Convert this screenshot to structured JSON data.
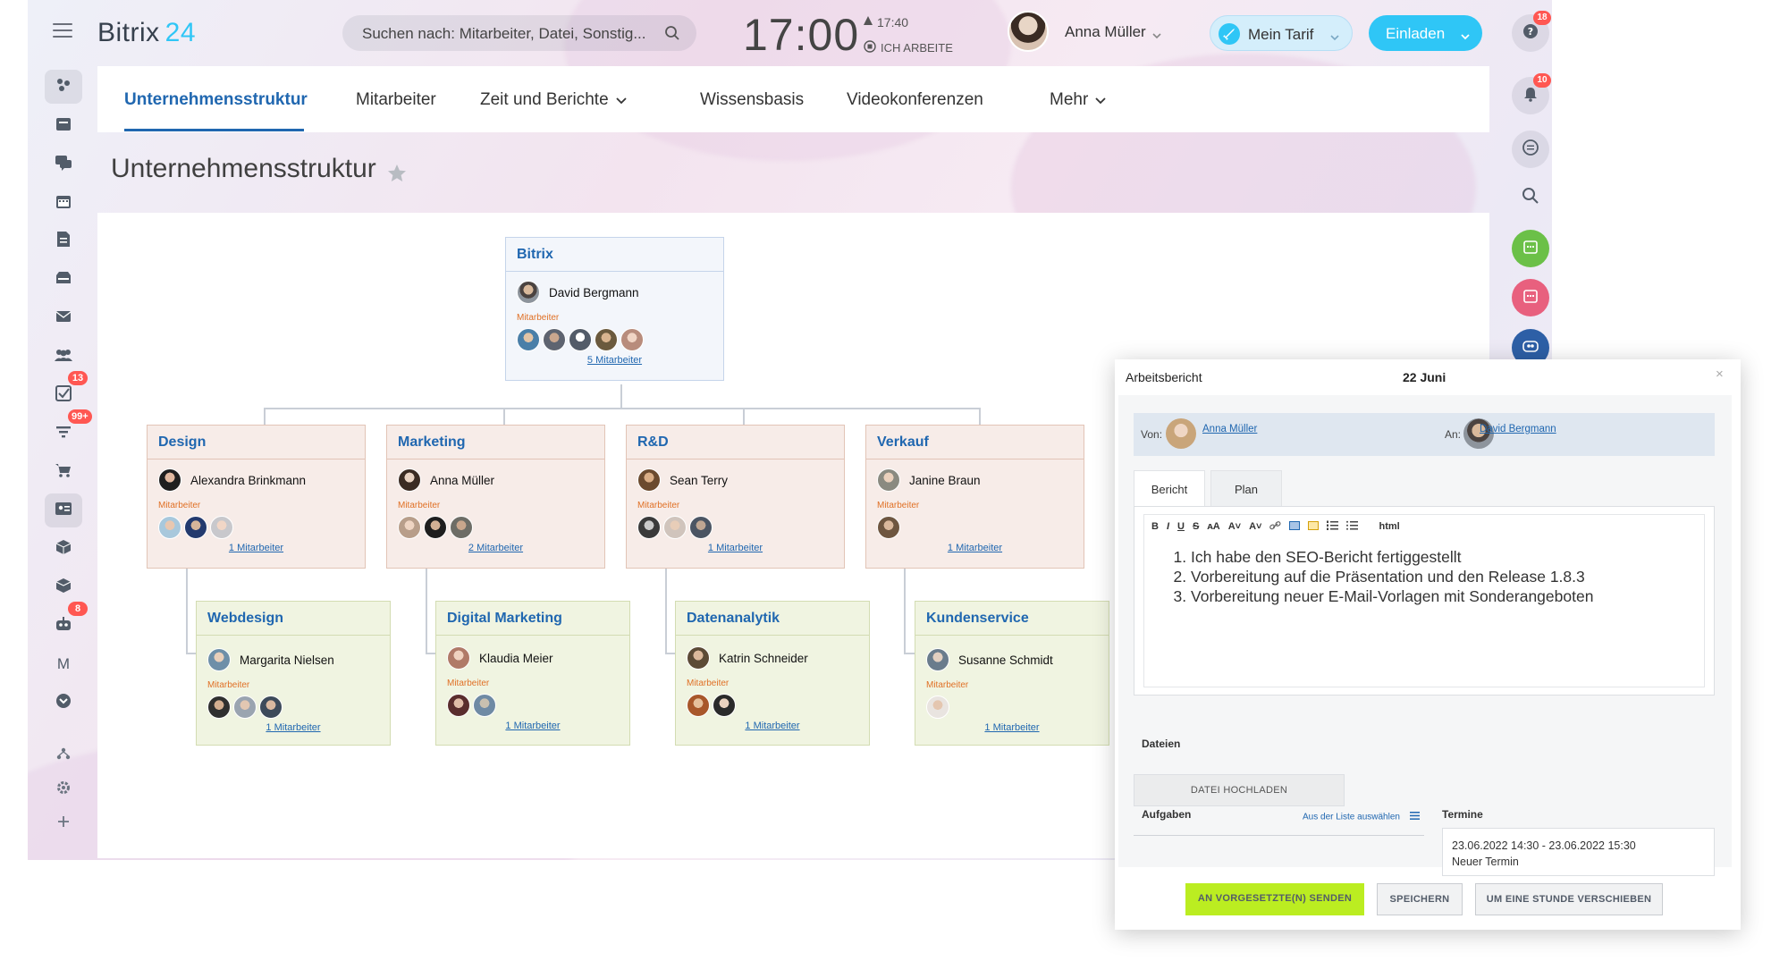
{
  "header": {
    "logo_main": "Bitrix",
    "logo_num": "24",
    "search_placeholder": "Suchen nach: Mitarbeiter, Datei, Sonstig...",
    "clock": "17:00",
    "work_time": "17:40",
    "work_status": "ICH ARBEITE",
    "user_name": "Anna Müller",
    "tariff_label": "Mein Tarif",
    "invite_label": "Einladen"
  },
  "left_sidebar": {
    "badges": {
      "tasks": "13",
      "crm": "99+",
      "robots": "8"
    },
    "mail_letter": "M"
  },
  "tabs": [
    {
      "label": "Unternehmensstruktur"
    },
    {
      "label": "Mitarbeiter"
    },
    {
      "label": "Zeit und Berichte"
    },
    {
      "label": "Wissensbasis"
    },
    {
      "label": "Videokonferenzen"
    },
    {
      "label": "Mehr"
    }
  ],
  "page_title": "Unternehmensstruktur",
  "org": {
    "role_label": "Mitarbeiter",
    "root": {
      "name": "Bitrix",
      "head": "David Bergmann",
      "count": "5 Mitarbeiter"
    },
    "level1": [
      {
        "name": "Design",
        "head": "Alexandra Brinkmann",
        "count": "1 Mitarbeiter"
      },
      {
        "name": "Marketing",
        "head": "Anna Müller",
        "count": "2 Mitarbeiter"
      },
      {
        "name": "R&D",
        "head": "Sean Terry",
        "count": "1 Mitarbeiter"
      },
      {
        "name": "Verkauf",
        "head": "Janine Braun",
        "count": "1 Mitarbeiter"
      }
    ],
    "level2": [
      {
        "name": "Webdesign",
        "head": "Margarita Nielsen",
        "count": "1 Mitarbeiter"
      },
      {
        "name": "Digital Marketing",
        "head": "Klaudia Meier",
        "count": "1 Mitarbeiter"
      },
      {
        "name": "Datenanalytik",
        "head": "Katrin Schneider",
        "count": "1 Mitarbeiter"
      },
      {
        "name": "Kundenservice",
        "head": "Susanne Schmidt",
        "count": "1 Mitarbeiter"
      }
    ]
  },
  "right_sidebar": {
    "badges": {
      "help": "18",
      "notifications": "10"
    }
  },
  "report": {
    "title": "Arbeitsbericht",
    "date": "22 Juni",
    "close": "×",
    "from_label": "Von:",
    "from_name": "Anna Müller",
    "to_label": "An:",
    "to_name": "David Bergmann",
    "tab_report": "Bericht",
    "tab_plan": "Plan",
    "toolbar_html": "html",
    "items": [
      "Ich habe den SEO-Bericht fertiggestellt",
      "Vorbereitung auf die Präsentation und den Release 1.8.3",
      "Vorbereitung neuer E-Mail-Vorlagen mit Sonderangeboten"
    ],
    "files_label": "Dateien",
    "upload_label": "DATEI HOCHLADEN",
    "tasks_label": "Aufgaben",
    "choose_from_list": "Aus der Liste auswählen",
    "appointments_label": "Termine",
    "appointment_time": "23.06.2022 14:30 - 23.06.2022 15:30",
    "appointment_new": "Neuer Termin",
    "btn_send": "AN VORGESETZTE(N) SENDEN",
    "btn_save": "SPEICHERN",
    "btn_postpone": "UM EINE STUNDE VERSCHIEBEN"
  },
  "colors": {
    "accent_blue": "#2067b0",
    "brand_cyan": "#2fc6f6",
    "badge_red": "#ff5752",
    "send_green": "#bbed21"
  }
}
